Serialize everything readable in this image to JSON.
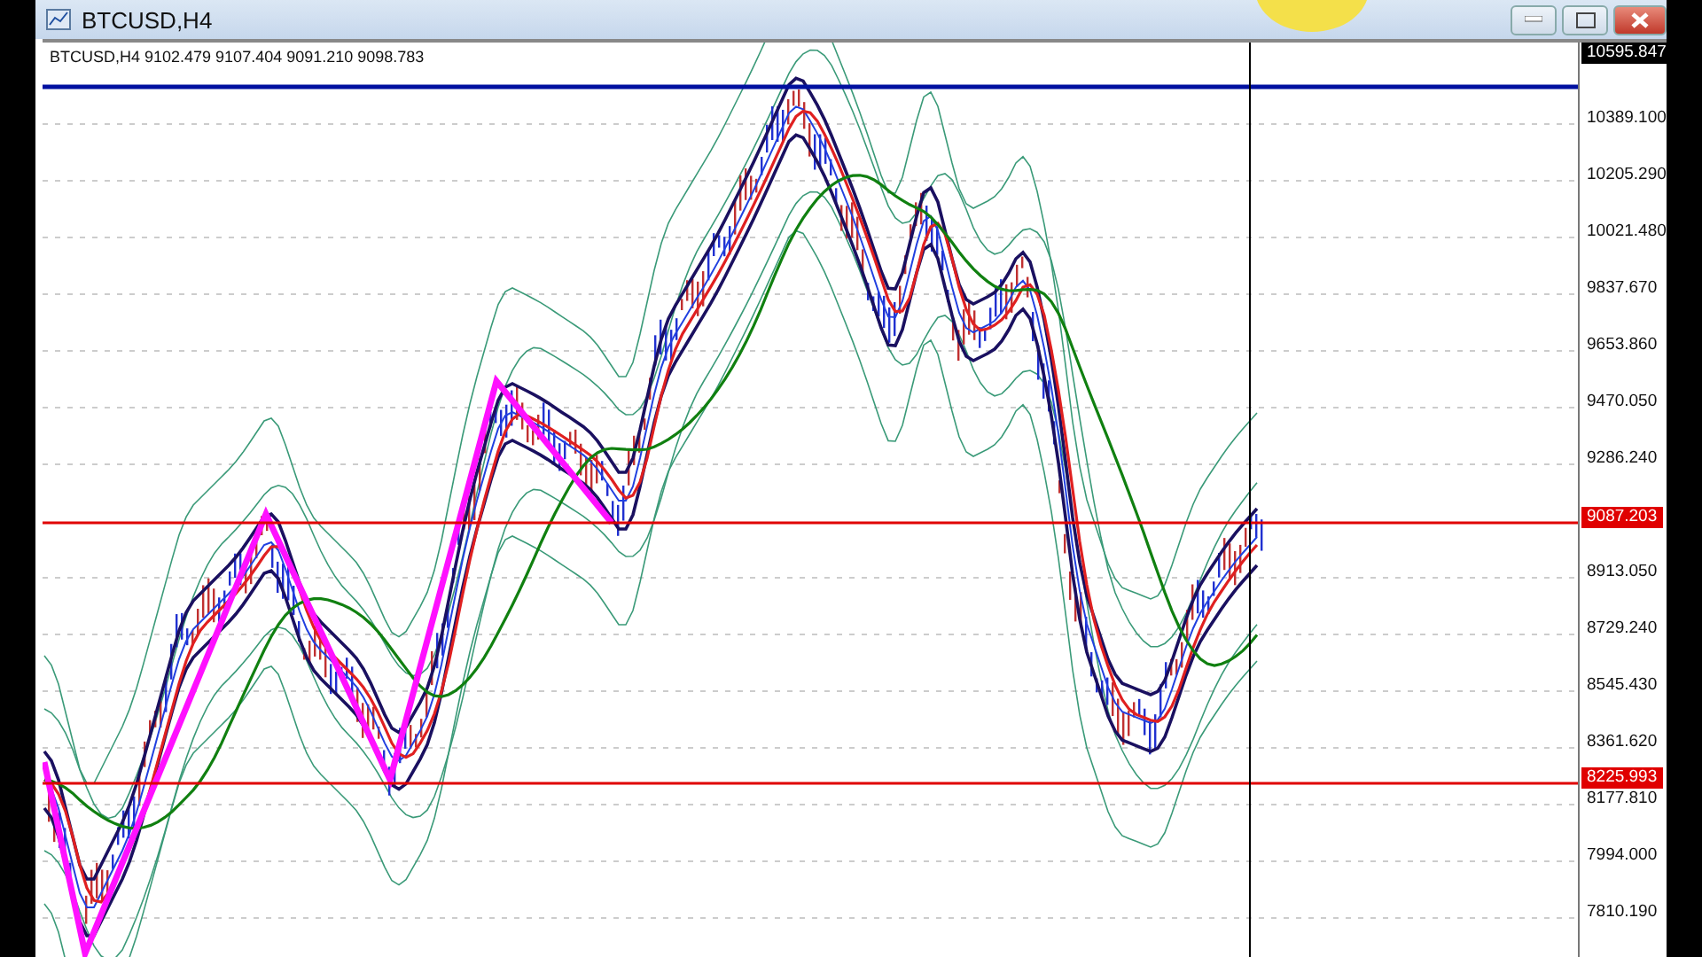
{
  "window": {
    "title": "BTCUSD,H4"
  },
  "chart": {
    "header": "BTCUSD,H4  9102.479 9107.404 9091.210 9098.783",
    "price_axis": [
      "10389.100",
      "10205.290",
      "10021.480",
      "9837.670",
      "9653.860",
      "9470.050",
      "9286.240",
      "8913.050",
      "8729.240",
      "8545.430",
      "8361.620",
      "8177.810",
      "7994.000",
      "7810.190"
    ],
    "price_tags": [
      {
        "text": "10595.847",
        "kind": "bid"
      },
      {
        "text": "9087.203",
        "kind": "level"
      },
      {
        "text": "8225.993",
        "kind": "level"
      }
    ]
  }
}
